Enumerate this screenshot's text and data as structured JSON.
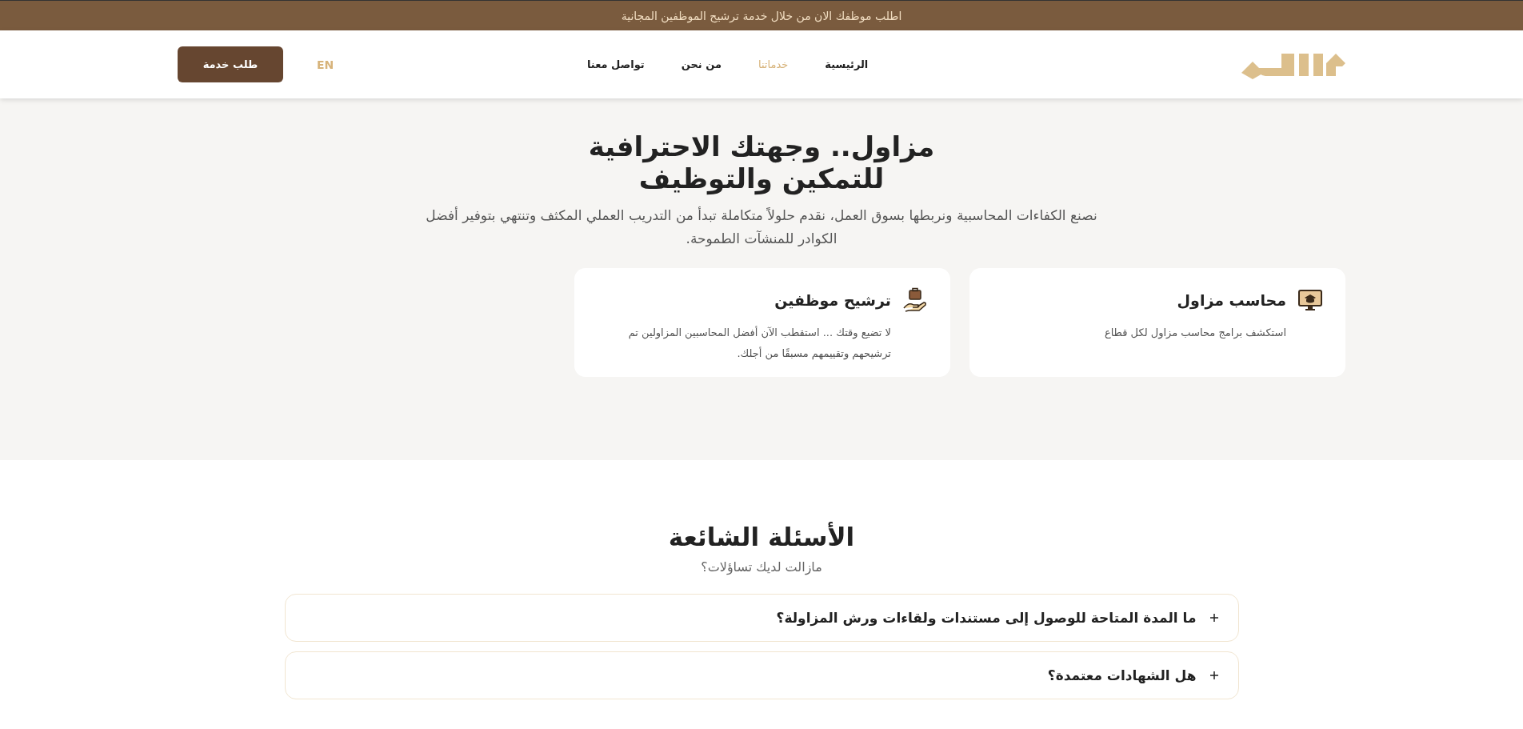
{
  "announcement": "اطلب موظفك الان من خلال خدمة ترشيح الموظفين المجانية",
  "nav": {
    "items": [
      {
        "label": "الرئيسية",
        "selected": false
      },
      {
        "label": "خدماتنا",
        "selected": true
      },
      {
        "label": "من نحن",
        "selected": false
      },
      {
        "label": "تواصل معنا",
        "selected": false
      }
    ],
    "language": "EN",
    "cta": "طلب خدمة"
  },
  "hero": {
    "title": "مزاول.. وجهتك الاحترافية للتمكين والتوظيف",
    "subtitle": "نصنع الكفاءات المحاسبية ونربطها بسوق العمل، نقدم حلولاً متكاملة تبدأ من التدريب العملي المكثف وتنتهي بتوفير أفضل الكوادر للمنشآت الطموحة.",
    "cards": [
      {
        "kind": "monitor",
        "title": "محاسب مزاول",
        "text": "استكشف برامج محاسب مزاول لكل قطاع"
      },
      {
        "kind": "briefcase",
        "title": "ترشيح موظفين",
        "text": "لا تضيع وقتك ... استقطب الآن أفضل المحاسبين المزاولين تم ترشيحهم وتقييمهم مسبقًا من أجلك."
      }
    ]
  },
  "faq": {
    "title": "الأسئلة الشائعة",
    "subtitle": "مازالت لديك تساؤلات؟",
    "items": [
      {
        "question": "ما المدة المتاحة للوصول إلى مستندات ولقاءات ورش المزاولة؟",
        "expanded": false
      },
      {
        "question": "هل الشهادات معتمدة؟",
        "expanded": false
      }
    ]
  }
}
